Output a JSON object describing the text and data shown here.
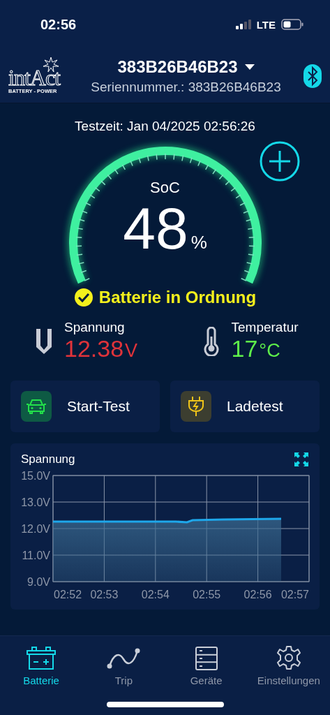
{
  "status_bar": {
    "time": "02:56",
    "network": "LTE"
  },
  "header": {
    "logo": {
      "name": "intAct",
      "tagline": "BATTERY - POWER"
    },
    "device": "383B26B46B23",
    "serial": "Seriennummer.: 383B26B46B23"
  },
  "test_time": "Testzeit: Jan 04/2025 02:56:26",
  "gauge": {
    "label": "SoC",
    "value": "48",
    "unit": "%",
    "status": "Batterie in Ordnung"
  },
  "metrics": [
    {
      "kind": "voltage",
      "label": "Spannung",
      "value": "12.38",
      "unit": "V",
      "color": "#e0333a"
    },
    {
      "kind": "temperature",
      "label": "Temperatur",
      "value": "17",
      "unit": "°C",
      "color": "#5ef04a"
    }
  ],
  "actions": [
    {
      "kind": "start",
      "label": "Start-Test"
    },
    {
      "kind": "charge",
      "label": "Ladetest"
    }
  ],
  "chart": {
    "title": "Spannung",
    "y_labels": [
      "15.0V",
      "13.0V",
      "12.0V",
      "11.0V",
      "9.0V"
    ],
    "x_labels": [
      "02:52",
      "02:53",
      "02:54",
      "02:55",
      "02:56",
      "02:57"
    ]
  },
  "nav": [
    {
      "kind": "battery",
      "label": "Batterie",
      "selected": true
    },
    {
      "kind": "trip",
      "label": "Trip",
      "selected": false
    },
    {
      "kind": "devices",
      "label": "Geräte",
      "selected": false
    },
    {
      "kind": "settings",
      "label": "Einstellungen",
      "selected": false
    }
  ]
}
